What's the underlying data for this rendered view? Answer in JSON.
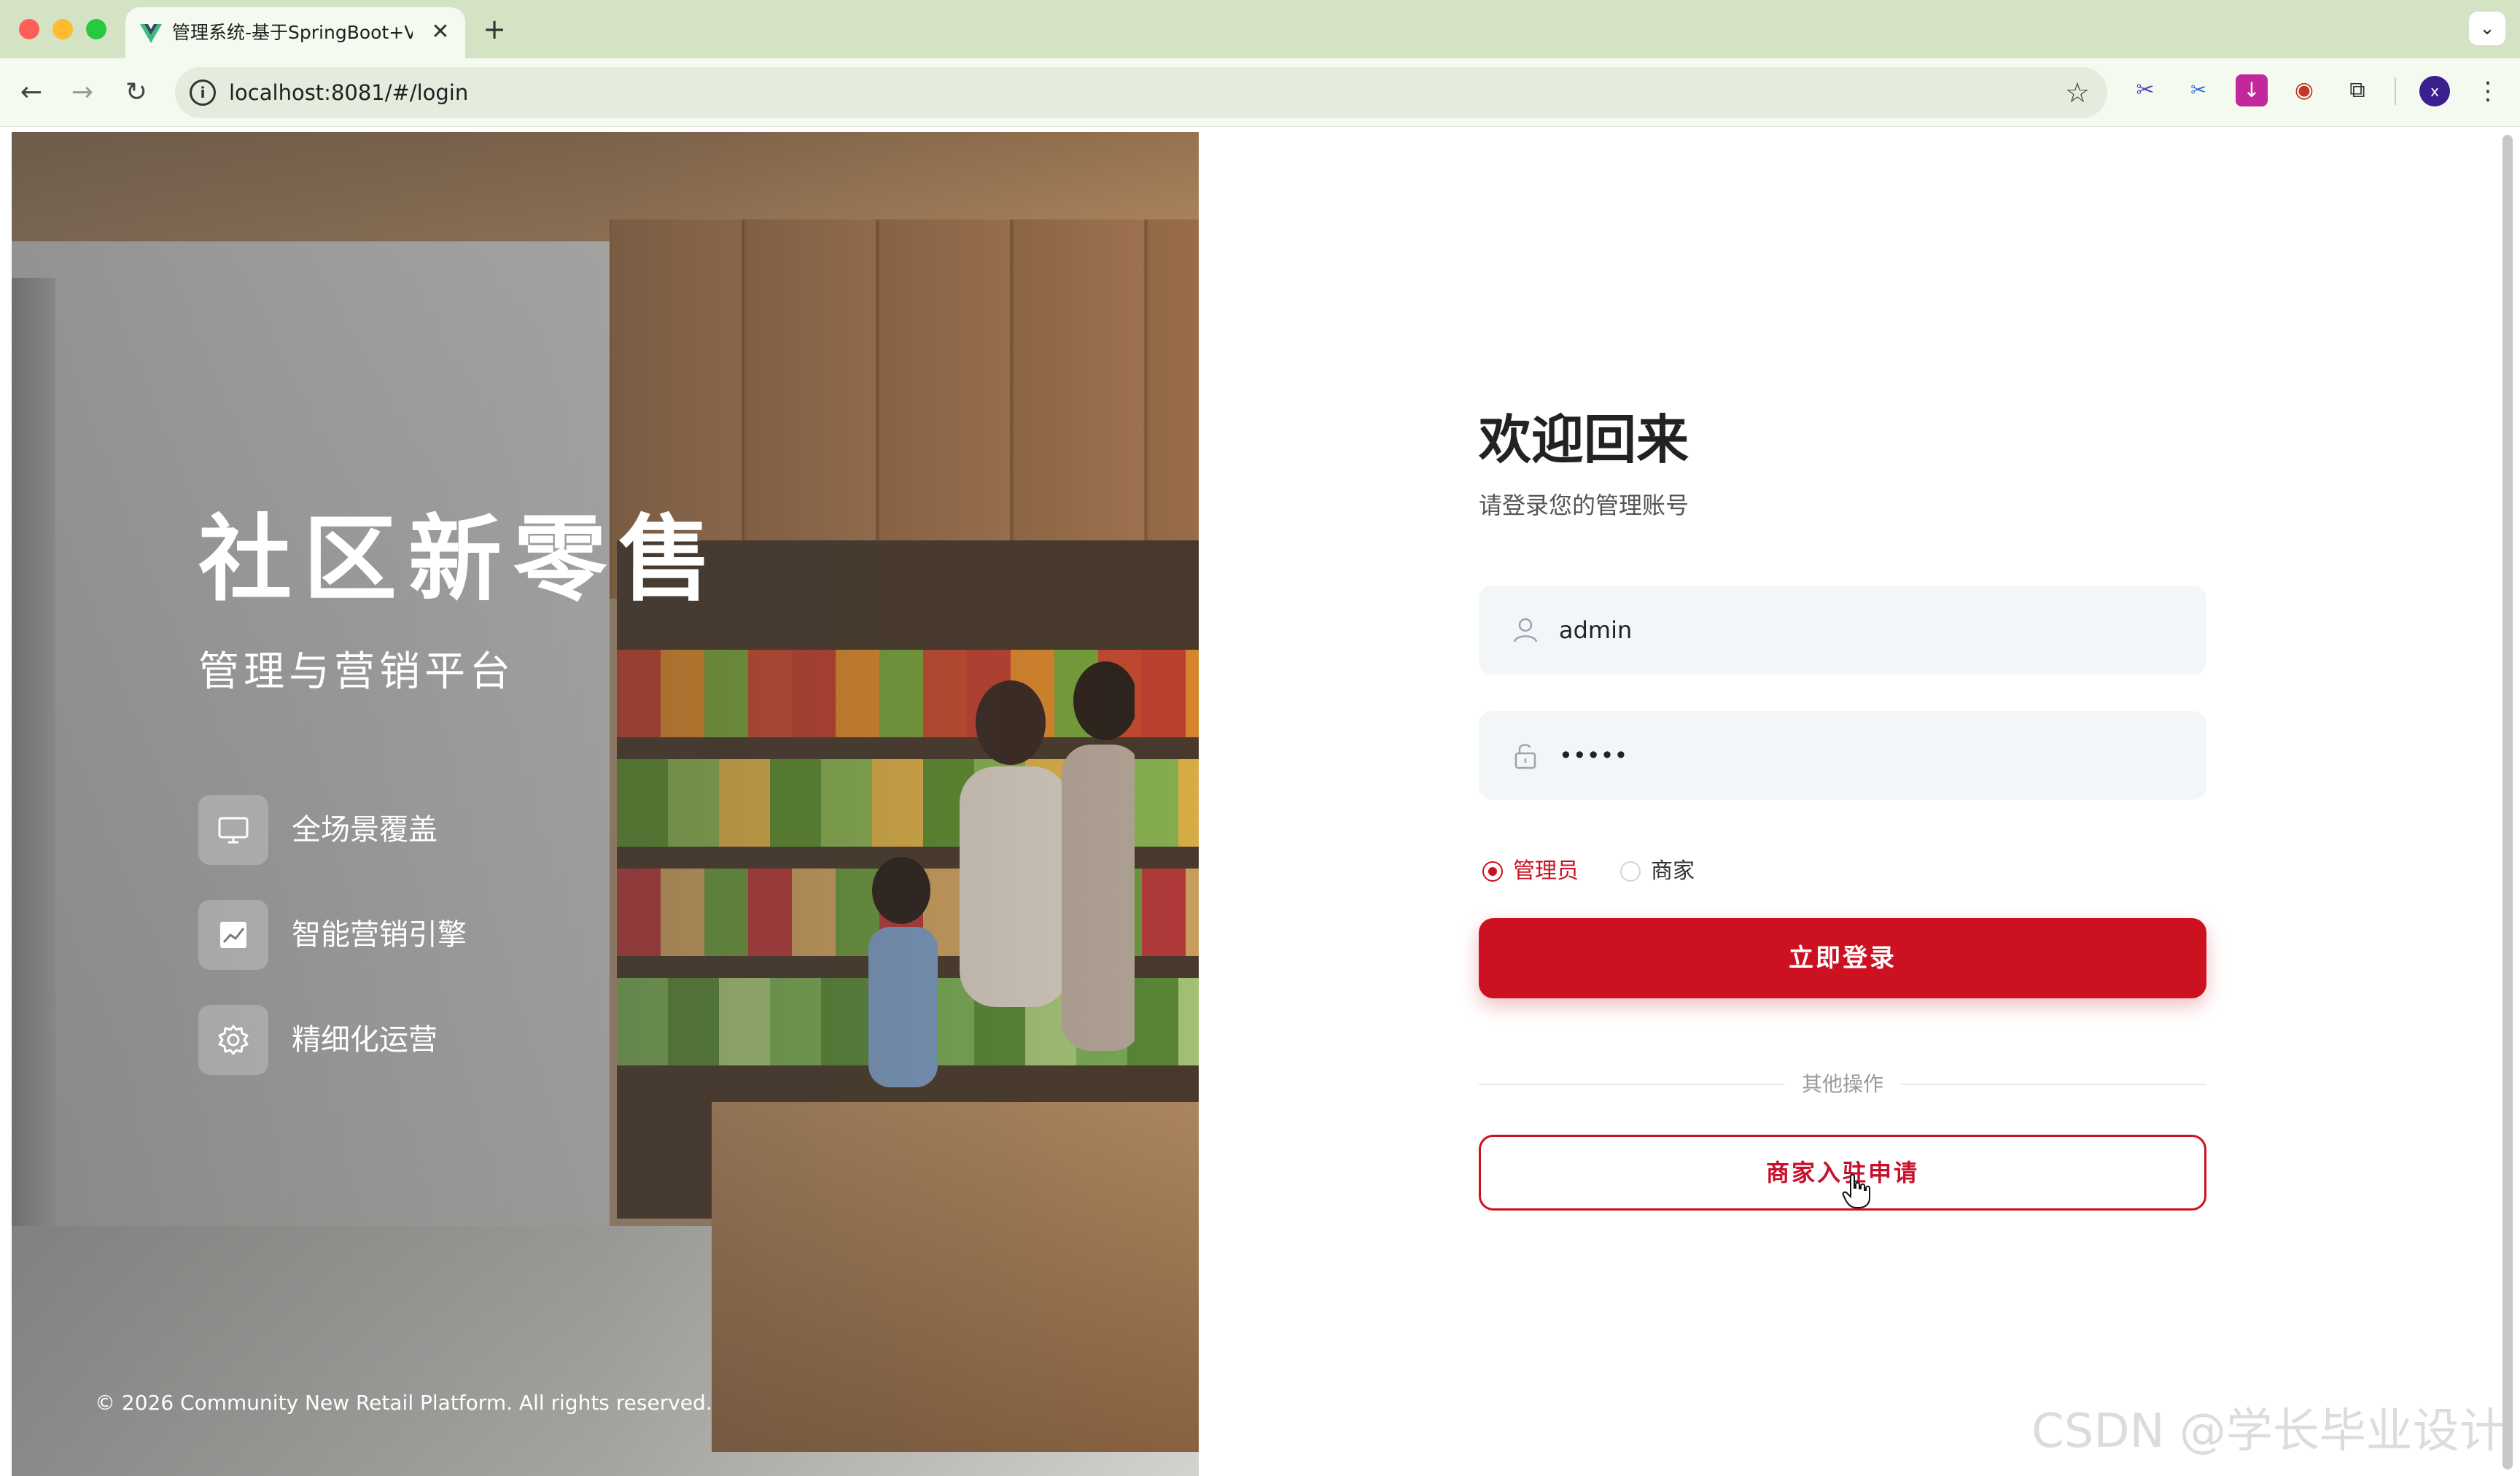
{
  "browser": {
    "tab_title": "管理系统-基于SpringBoot+Vu",
    "tab_close": "✕",
    "new_tab": "+",
    "tab_menu": "⌄",
    "url": "localhost:8081/#/login",
    "profile_initial": "x"
  },
  "hero": {
    "title": "社区新零售",
    "subtitle": "管理与营销平台",
    "features": [
      {
        "label": "全场景覆盖",
        "icon": "monitor-icon"
      },
      {
        "label": "智能营销引擎",
        "icon": "trend-chart-icon"
      },
      {
        "label": "精细化运营",
        "icon": "gear-icon"
      }
    ],
    "footer": "© 2026 Community New Retail Platform. All rights reserved."
  },
  "login": {
    "title": "欢迎回来",
    "subtitle": "请登录您的管理账号",
    "username_value": "admin",
    "password_value": "•••••",
    "roles": [
      {
        "label": "管理员",
        "selected": true
      },
      {
        "label": "商家",
        "selected": false
      }
    ],
    "submit_label": "立即登录",
    "divider_text": "其他操作",
    "apply_label": "商家入驻申请"
  },
  "watermark": "CSDN @学长毕业设计",
  "colors": {
    "accent": "#cc1120",
    "tabbar": "#d3e3c4",
    "input_bg": "#f3f6f9"
  }
}
